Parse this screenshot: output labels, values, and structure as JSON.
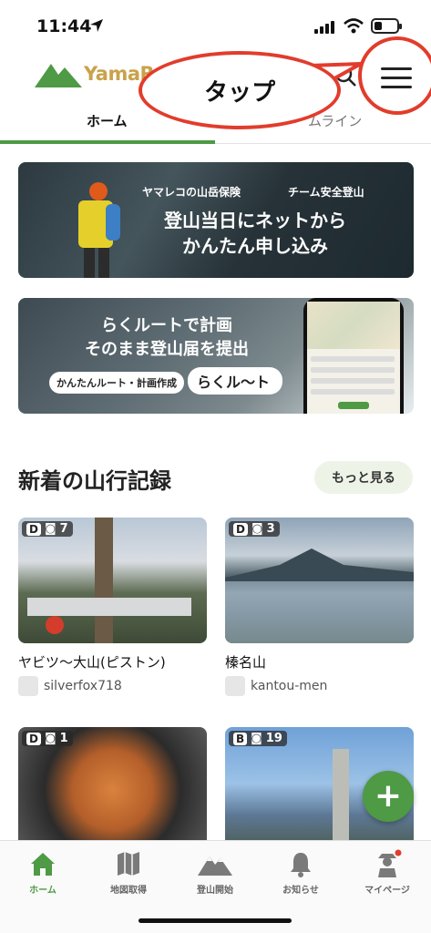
{
  "status": {
    "time": "11:44"
  },
  "header": {
    "logo_text": "YamaR",
    "annotation": "タップ"
  },
  "tabs": [
    {
      "label": "ホーム"
    },
    {
      "label": "ムライン"
    }
  ],
  "banners": {
    "insurance": {
      "top_left": "ヤマレコの山岳保険",
      "top_right": "チーム安全登山",
      "line1": "登山当日にネットから",
      "line2": "かんたん申し込み"
    },
    "route": {
      "line1": "らくルートで計画",
      "line2": "そのまま登山届を提出",
      "chip": "かんたんルート・計画作成",
      "logo": "らくル〜ト"
    }
  },
  "section": {
    "title": "新着の山行記録",
    "more": "もっと見る"
  },
  "records": [
    {
      "level": "D",
      "photos": "7",
      "title": "ヤビツ〜大山(ピストン)",
      "user": "silverfox718"
    },
    {
      "level": "D",
      "photos": "3",
      "title": "榛名山",
      "user": "kantou-men"
    },
    {
      "level": "D",
      "photos": "1",
      "title": "",
      "user": ""
    },
    {
      "level": "B",
      "photos": "19",
      "title": "",
      "user": ""
    }
  ],
  "fab": {
    "label": "+"
  },
  "nav": [
    {
      "label": "ホーム"
    },
    {
      "label": "地図取得"
    },
    {
      "label": "登山開始"
    },
    {
      "label": "お知らせ"
    },
    {
      "label": "マイページ"
    }
  ],
  "colors": {
    "accent": "#4e9a45",
    "annotation": "#e23c2c",
    "logo": "#c9a24a"
  }
}
